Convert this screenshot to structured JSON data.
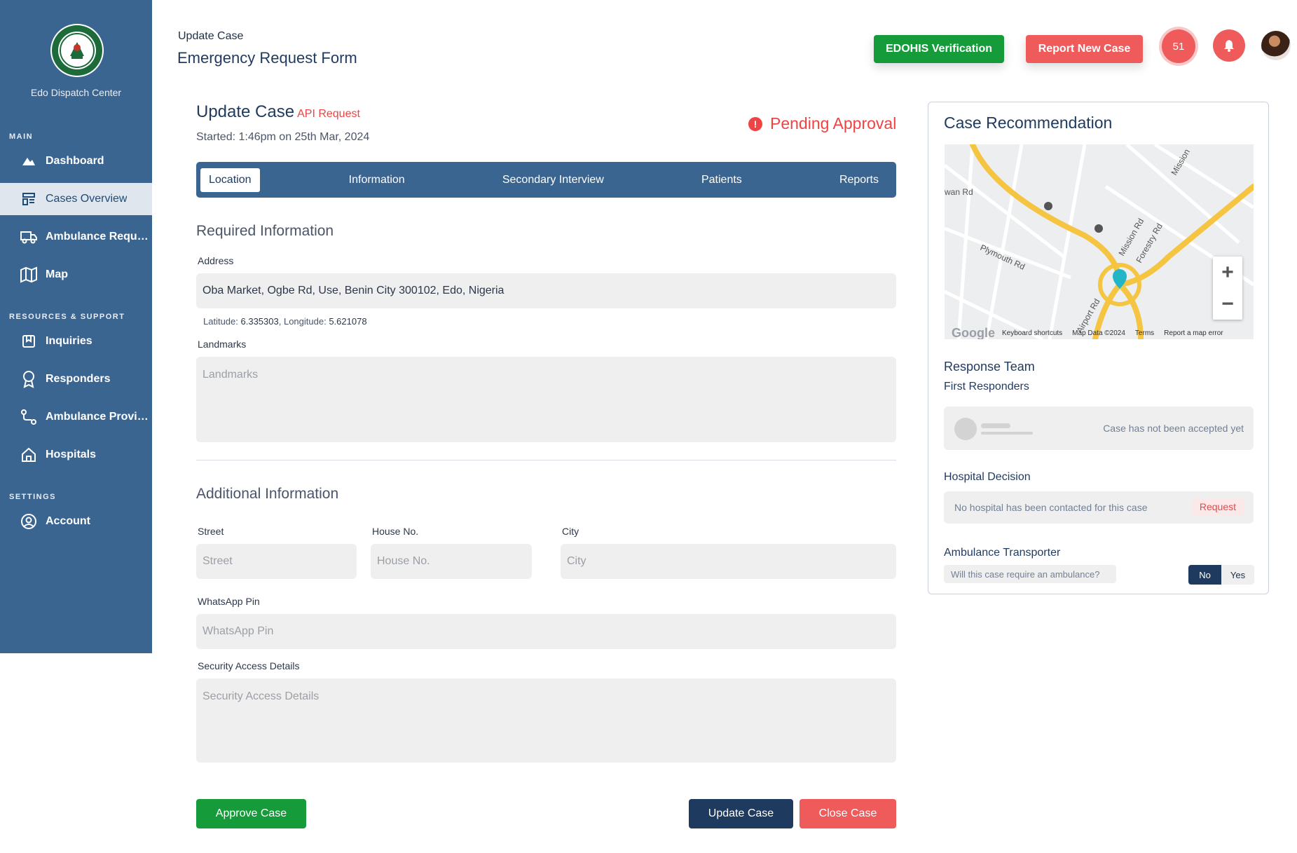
{
  "colors": {
    "sidebar": "#3b6591",
    "green": "#169b3a",
    "red": "#ef5a5a",
    "navy": "#1f3a5f"
  },
  "sidebar": {
    "org_name": "Edo Dispatch Center",
    "sections": {
      "main": "MAIN",
      "resources": "RESOURCES & SUPPORT",
      "settings": "SETTINGS"
    },
    "items": [
      {
        "label": "Dashboard",
        "icon": "dashboard-icon"
      },
      {
        "label": "Cases Overview",
        "icon": "cases-icon"
      },
      {
        "label": "Ambulance Requests",
        "icon": "truck-icon"
      },
      {
        "label": "Map",
        "icon": "map-icon"
      },
      {
        "label": "Inquiries",
        "icon": "inquiries-icon"
      },
      {
        "label": "Responders",
        "icon": "award-icon"
      },
      {
        "label": "Ambulance Providers",
        "icon": "route-icon"
      },
      {
        "label": "Hospitals",
        "icon": "home-icon"
      },
      {
        "label": "Account",
        "icon": "user-circle-icon"
      }
    ]
  },
  "header": {
    "breadcrumb": "Update Case",
    "title": "Emergency Request Form",
    "edohis_button": "EDOHIS Verification",
    "report_button": "Report New Case",
    "notification_count": "51"
  },
  "case": {
    "title": "Update Case",
    "tag": "API Request",
    "started": "Started: 1:46pm on 25th Mar, 2024",
    "status": "Pending Approval"
  },
  "tabs": [
    "Location",
    "Information",
    "Secondary Interview",
    "Patients",
    "Reports"
  ],
  "required": {
    "title": "Required Information",
    "address_label": "Address",
    "address_value": "Oba Market, Ogbe Rd, Use, Benin City 300102, Edo, Nigeria",
    "lat_label": "Latitude:",
    "lat_value": "6.335303",
    "lng_label": "Longitude:",
    "lng_value": "5.621078",
    "landmarks_label": "Landmarks",
    "landmarks_placeholder": "Landmarks"
  },
  "additional": {
    "title": "Additional Information",
    "street_label": "Street",
    "street_placeholder": "Street",
    "house_label": "House No.",
    "house_placeholder": "House No.",
    "city_label": "City",
    "city_placeholder": "City",
    "whatsapp_label": "WhatsApp Pin",
    "whatsapp_placeholder": "WhatsApp Pin",
    "security_label": "Security Access Details",
    "security_placeholder": "Security Access Details"
  },
  "actions": {
    "approve": "Approve Case",
    "update": "Update Case",
    "close": "Close Case"
  },
  "recommendation": {
    "title": "Case Recommendation",
    "map": {
      "roads": [
        "wan Rd",
        "Mission",
        "Plymouth Rd",
        "Mission Rd",
        "Forestry Rd",
        "Airport Rd"
      ],
      "footer": [
        "Keyboard shortcuts",
        "Map Data ©2024",
        "Terms",
        "Report a map error"
      ],
      "brand": "Google"
    },
    "response_team": "Response Team",
    "first_responders": "First Responders",
    "responders_msg": "Case has not been accepted yet",
    "hospital_decision": "Hospital Decision",
    "hospital_msg": "No hospital has been contacted for this case",
    "hospital_request": "Request",
    "ambulance_title": "Ambulance Transporter",
    "ambulance_question": "Will this case require an ambulance?",
    "toggle_no": "No",
    "toggle_yes": "Yes"
  }
}
